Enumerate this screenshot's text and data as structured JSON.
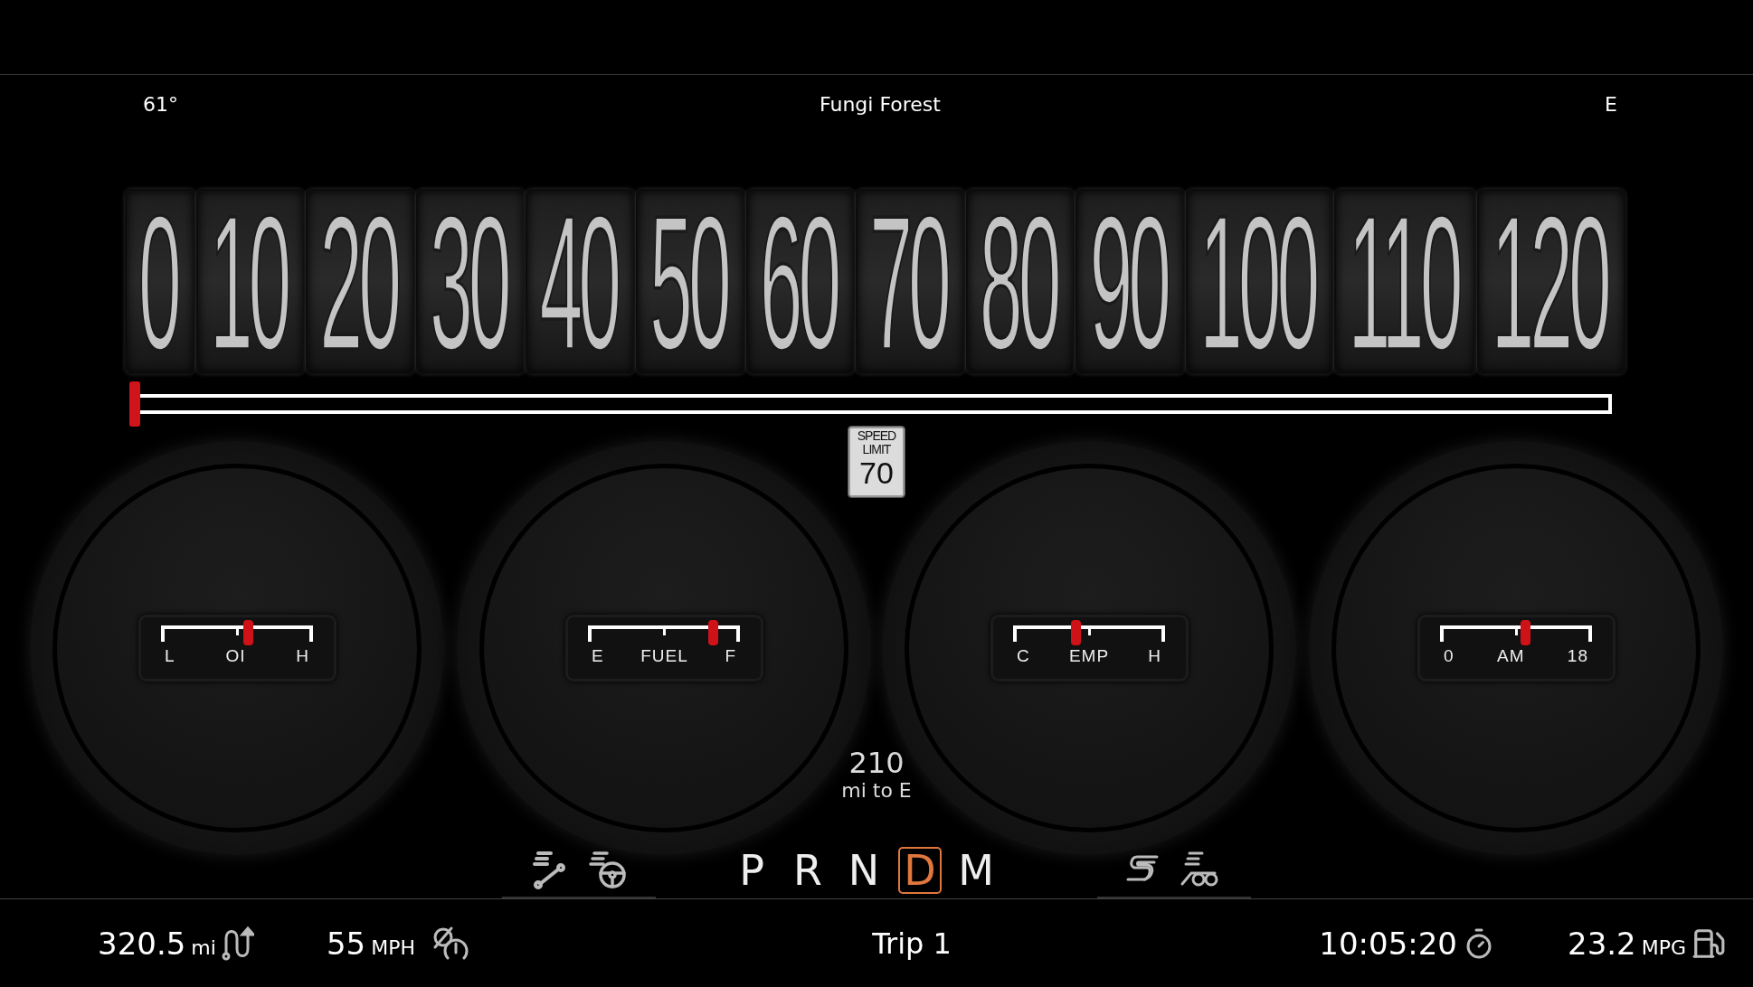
{
  "header": {
    "temperature": "61°",
    "location": "Fungi Forest",
    "compass": "E"
  },
  "speedometer": {
    "ticks": [
      "0",
      "10",
      "20",
      "30",
      "40",
      "50",
      "60",
      "70",
      "80",
      "90",
      "100",
      "110",
      "120"
    ],
    "level": 0
  },
  "speed_limit": {
    "line_1": "SPEED",
    "line_2": "LIMIT",
    "value": "70"
  },
  "gauges": [
    {
      "low": "L",
      "name": "OI",
      "high": "H",
      "level": 0.57
    },
    {
      "low": "E",
      "name": "FUEL",
      "high": "F",
      "level": 0.82
    },
    {
      "low": "C",
      "name": "EMP",
      "high": "H",
      "level": 0.41
    },
    {
      "low": "0",
      "name": "AM",
      "high": "18",
      "level": 0.56
    }
  ],
  "range": {
    "value": "210",
    "label": "mi to E"
  },
  "gears": [
    {
      "label": "P",
      "selected": false
    },
    {
      "label": "R",
      "selected": false
    },
    {
      "label": "N",
      "selected": false
    },
    {
      "label": "D",
      "selected": true
    },
    {
      "label": "M",
      "selected": false
    }
  ],
  "trip_bar": {
    "odometer": {
      "value": "320.5",
      "unit": "mi"
    },
    "speed": {
      "value": "55",
      "unit": "MPH"
    },
    "title": "Trip 1",
    "timer": "10:05:20",
    "economy": {
      "value": "23.2",
      "unit": "MPG"
    }
  }
}
